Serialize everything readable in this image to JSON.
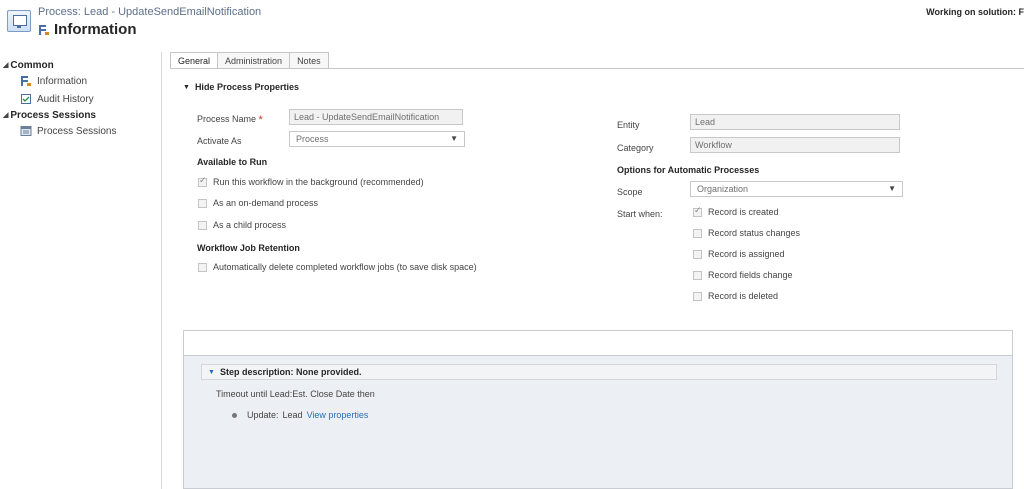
{
  "header": {
    "subtitle": "Process: Lead - UpdateSendEmailNotification",
    "title": "Information",
    "solution": "Working on solution: F"
  },
  "nav": {
    "groups": [
      {
        "label": "Common",
        "items": [
          {
            "label": "Information",
            "icon": "workflow-icon"
          },
          {
            "label": "Audit History",
            "icon": "audit-history-icon"
          }
        ]
      },
      {
        "label": "Process Sessions",
        "items": [
          {
            "label": "Process Sessions",
            "icon": "process-sessions-icon"
          }
        ]
      }
    ]
  },
  "tabs": [
    {
      "label": "General",
      "active": true
    },
    {
      "label": "Administration"
    },
    {
      "label": "Notes"
    }
  ],
  "section": {
    "title": "Hide Process Properties"
  },
  "fields": {
    "process_name_label": "Process Name",
    "process_name_required": "*",
    "process_name_value": "Lead - UpdateSendEmailNotification",
    "activate_as_label": "Activate As",
    "activate_as_value": "Process",
    "entity_label": "Entity",
    "entity_value": "Lead",
    "category_label": "Category",
    "category_value": "Workflow"
  },
  "available_to_run": {
    "title": "Available to Run",
    "options": [
      {
        "label": "Run this workflow in the background (recommended)",
        "checked": true
      },
      {
        "label": "As an on-demand process",
        "checked": false
      },
      {
        "label": "As a child process",
        "checked": false
      }
    ]
  },
  "retention": {
    "title": "Workflow Job Retention",
    "option": {
      "label": "Automatically delete completed workflow jobs (to save disk space)",
      "checked": false
    }
  },
  "automatic": {
    "title": "Options for Automatic Processes",
    "scope_label": "Scope",
    "scope_value": "Organization",
    "start_when_label": "Start when:",
    "options": [
      {
        "label": "Record is created",
        "checked": true
      },
      {
        "label": "Record status changes",
        "checked": false
      },
      {
        "label": "Record is assigned",
        "checked": false
      },
      {
        "label": "Record fields change",
        "checked": false
      },
      {
        "label": "Record is deleted",
        "checked": false
      }
    ]
  },
  "step": {
    "description": "Step description: None provided.",
    "condition": "Timeout until Lead:Est. Close Date then",
    "action_prefix": "Update:",
    "action_entity": "Lead",
    "action_link": "View properties"
  }
}
